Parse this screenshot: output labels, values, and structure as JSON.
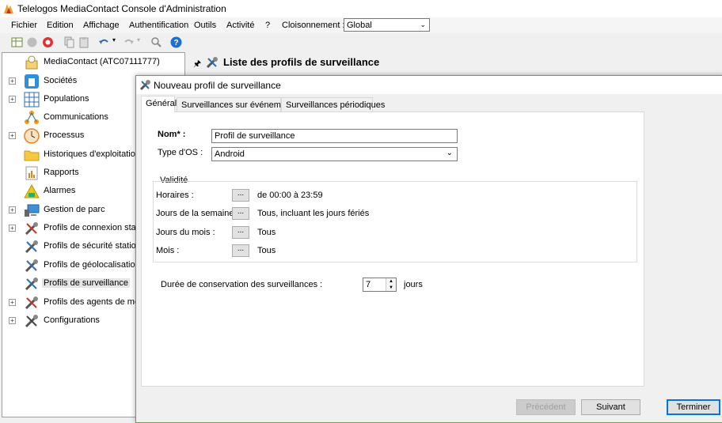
{
  "window": {
    "title": "Telelogos MediaContact Console d'Administration"
  },
  "menu": {
    "items": [
      "Fichier",
      "Edition",
      "Affichage",
      "Authentification",
      "Outils",
      "Activité",
      "?",
      "Cloisonnement :"
    ],
    "cloisonnement_value": "Global"
  },
  "tree": {
    "root": "MediaContact (ATC07111777)",
    "items": [
      {
        "label": "Sociétés",
        "icon": "building-icon"
      },
      {
        "label": "Populations",
        "icon": "calendar-grid-icon"
      },
      {
        "label": "Communications",
        "icon": "network-icon"
      },
      {
        "label": "Processus",
        "icon": "clock-icon"
      },
      {
        "label": "Historiques d'exploitation",
        "icon": "folder-icon"
      },
      {
        "label": "Rapports",
        "icon": "report-icon"
      },
      {
        "label": "Alarmes",
        "icon": "alarm-icon"
      },
      {
        "label": "Gestion de parc",
        "icon": "computer-icon"
      },
      {
        "label": "Profils de connexion station",
        "icon": "tools-icon"
      },
      {
        "label": "Profils de sécurité station",
        "icon": "tools-icon"
      },
      {
        "label": "Profils de géolocalisation",
        "icon": "tools-icon"
      },
      {
        "label": "Profils de surveillance",
        "icon": "tools-icon"
      },
      {
        "label": "Profils des agents de messa",
        "icon": "tools-icon"
      },
      {
        "label": "Configurations",
        "icon": "tools-icon"
      }
    ]
  },
  "right_panel": {
    "title": "Liste des profils de surveillance",
    "pin": "⊥"
  },
  "dialog": {
    "title": "Nouveau profil de surveillance",
    "tabs": [
      "Général",
      "Surveillances sur événement",
      "Surveillances périodiques"
    ],
    "form": {
      "nom_label": "Nom* :",
      "nom_value": "Profil de surveillance",
      "os_label": "Type d'OS :",
      "os_value": "Android",
      "validite_title": "Validité",
      "horaires_label": "Horaires :",
      "horaires_value": "de 00:00 à 23:59",
      "jours_semaine_label": "Jours de la semaine :",
      "jours_semaine_value": "Tous, incluant les jours fériés",
      "jours_mois_label": "Jours du mois :",
      "jours_mois_value": "Tous",
      "mois_label": "Mois :",
      "mois_value": "Tous",
      "dots": "...",
      "duree_label": "Durée de conservation des surveillances :",
      "duree_value": "7",
      "duree_unit": "jours"
    },
    "buttons": {
      "previous": "Précédent",
      "next": "Suivant",
      "finish": "Terminer"
    }
  }
}
